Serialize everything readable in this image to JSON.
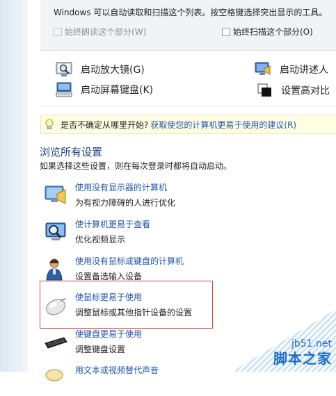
{
  "scan": {
    "text": "Windows 可以自动读取和扫描这个列表。按空格键选择突出显示的工具。",
    "always_read_label": "始终朗读这个部分(W)",
    "always_scan_label": "始终扫描这个部分(O)"
  },
  "tools": {
    "magnifier": "启动放大镜(G)",
    "narrator": "启动讲述人",
    "onscreen_keyboard": "启动屏幕键盘(K)",
    "high_contrast": "设置高对比"
  },
  "tip": {
    "prefix": "是否不确定从哪里开始?",
    "link": "获取使您的计算机更易于使用的建议(R)"
  },
  "browse": {
    "title": "浏览所有设置",
    "subtitle": "如果选择这些设置，则在每次登录时都将自动启动。",
    "items": [
      {
        "title": "使用没有显示器的计算机",
        "desc": "为有视力障碍的人进行优化",
        "icon": "monitor-speaker-icon"
      },
      {
        "title": "使计算机更易于查看",
        "desc": "优化视频显示",
        "icon": "magnifier-monitor-icon"
      },
      {
        "title": "使用没有鼠标或键盘的计算机",
        "desc": "设置备选输入设备",
        "icon": "person-icon"
      },
      {
        "title": "使鼠标更易于使用",
        "desc": "调整鼠标或其他指针设备的设置",
        "icon": "mouse-icon"
      },
      {
        "title": "使键盘更易于使用",
        "desc": "调整键盘设置",
        "icon": "keyboard-icon"
      },
      {
        "title": "用文本或视频替代声音",
        "desc": "",
        "icon": "speech-bubble-icon"
      }
    ]
  },
  "watermark": {
    "url": "jb51.net",
    "name": "脚本之家"
  },
  "colors": {
    "link": "#2056b0",
    "highlight_border": "#e0453a",
    "tip_bg": "#fffde2"
  }
}
